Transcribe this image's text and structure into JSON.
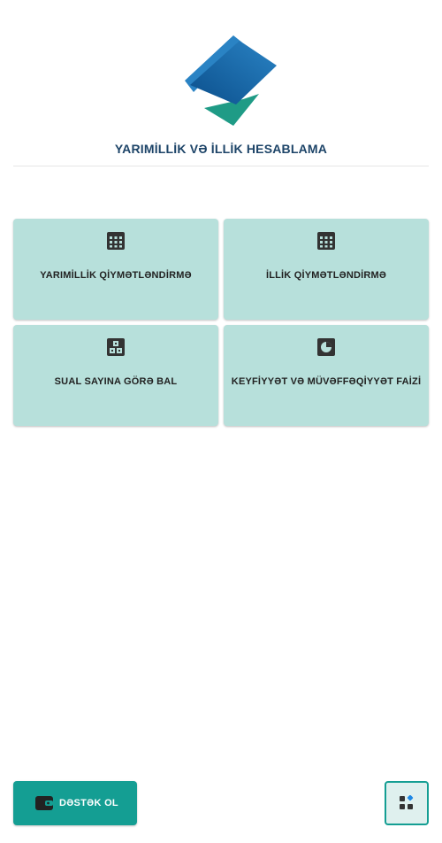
{
  "header": {
    "title": "YARIMİLLİK VƏ İLLİK HESABLAMA",
    "logo_icon": "diamond-logo-icon"
  },
  "menu": {
    "items": [
      {
        "label": "YARIMİLLİK QİYMƏTLƏNDİRMƏ",
        "icon": "calendar-grid-icon"
      },
      {
        "label": "İLLİK QİYMƏTLƏNDİRMƏ",
        "icon": "calendar-grid-icon"
      },
      {
        "label": "SUAL SAYINA GÖRƏ BAL",
        "icon": "blocks-icon"
      },
      {
        "label": "KEYFİYYƏT VƏ MÜVƏFFƏQİYYƏT FAİZİ",
        "icon": "pie-chart-icon"
      }
    ]
  },
  "footer": {
    "support_label": "DƏSTƏK OL",
    "support_icon": "wallet-icon",
    "apps_icon": "apps-grid-icon"
  },
  "colors": {
    "card_bg": "#b7e0db",
    "accent": "#149e93",
    "title": "#1d4468",
    "logo_blue": "#0d5a9c",
    "logo_teal": "#1f9b86"
  }
}
